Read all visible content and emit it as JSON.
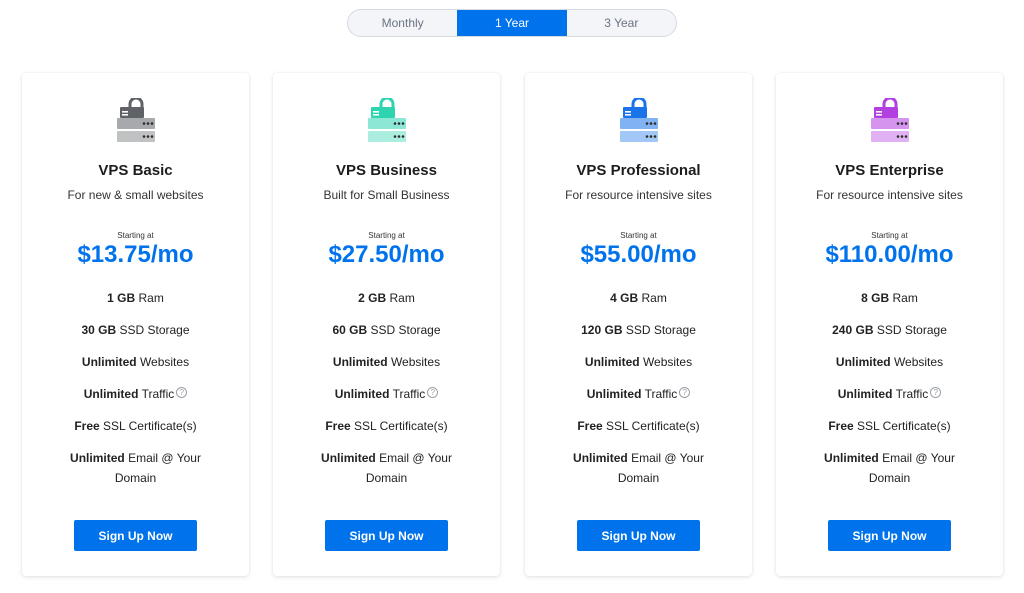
{
  "billing_toggle": {
    "options": [
      "Monthly",
      "1 Year",
      "3 Year"
    ],
    "selected": "1 Year"
  },
  "plans": [
    {
      "title": "VPS Basic",
      "subtitle": "For new & small websites",
      "starting_label": "Starting at",
      "price": "$13.75/mo",
      "icon": "server-lock-icon",
      "icon_color": "#5f6368",
      "features": {
        "ram": {
          "value": "1 GB",
          "label": "Ram"
        },
        "storage": {
          "value": "30 GB",
          "label": "SSD Storage"
        },
        "websites": {
          "value": "Unlimited",
          "label": "Websites"
        },
        "traffic": {
          "value": "Unlimited",
          "label": "Traffic"
        },
        "ssl": {
          "value": "Free",
          "label": "SSL Certificate(s)"
        },
        "email": {
          "value": "Unlimited",
          "label": "Email @ Your Domain"
        }
      },
      "cta": "Sign Up Now"
    },
    {
      "title": "VPS Business",
      "subtitle": "Built for Small Business",
      "starting_label": "Starting at",
      "price": "$27.50/mo",
      "icon": "server-lock-icon",
      "icon_color": "#2ed3b0",
      "features": {
        "ram": {
          "value": "2 GB",
          "label": "Ram"
        },
        "storage": {
          "value": "60 GB",
          "label": "SSD Storage"
        },
        "websites": {
          "value": "Unlimited",
          "label": "Websites"
        },
        "traffic": {
          "value": "Unlimited",
          "label": "Traffic"
        },
        "ssl": {
          "value": "Free",
          "label": "SSL Certificate(s)"
        },
        "email": {
          "value": "Unlimited",
          "label": "Email @ Your Domain"
        }
      },
      "cta": "Sign Up Now"
    },
    {
      "title": "VPS Professional",
      "subtitle": "For resource intensive sites",
      "starting_label": "Starting at",
      "price": "$55.00/mo",
      "icon": "server-lock-icon",
      "icon_color": "#1a73e8",
      "features": {
        "ram": {
          "value": "4 GB",
          "label": "Ram"
        },
        "storage": {
          "value": "120 GB",
          "label": "SSD Storage"
        },
        "websites": {
          "value": "Unlimited",
          "label": "Websites"
        },
        "traffic": {
          "value": "Unlimited",
          "label": "Traffic"
        },
        "ssl": {
          "value": "Free",
          "label": "SSL Certificate(s)"
        },
        "email": {
          "value": "Unlimited",
          "label": "Email @ Your Domain"
        }
      },
      "cta": "Sign Up Now"
    },
    {
      "title": "VPS Enterprise",
      "subtitle": "For resource intensive sites",
      "starting_label": "Starting at",
      "price": "$110.00/mo",
      "icon": "server-lock-icon",
      "icon_color": "#b23fe0",
      "features": {
        "ram": {
          "value": "8 GB",
          "label": "Ram"
        },
        "storage": {
          "value": "240 GB",
          "label": "SSD Storage"
        },
        "websites": {
          "value": "Unlimited",
          "label": "Websites"
        },
        "traffic": {
          "value": "Unlimited",
          "label": "Traffic"
        },
        "ssl": {
          "value": "Free",
          "label": "SSL Certificate(s)"
        },
        "email": {
          "value": "Unlimited",
          "label": "Email @ Your Domain"
        }
      },
      "cta": "Sign Up Now"
    }
  ],
  "help_icon_glyph": "?",
  "colors": {
    "accent": "#0073ec",
    "card_border": "#e5e7eb"
  }
}
